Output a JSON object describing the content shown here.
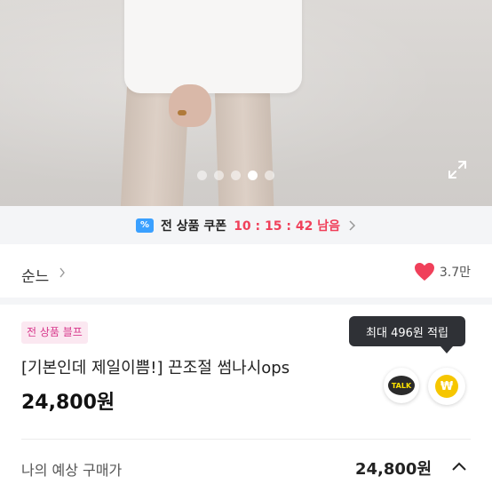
{
  "hero": {
    "slide_count": 5,
    "active_slide": 4
  },
  "coupon": {
    "icon": "coupon-ticket-icon",
    "label": "전 상품 쿠폰",
    "timer": "10 : 15 : 42 남음",
    "accent_color": "#f0405a"
  },
  "shop": {
    "name": "순느",
    "like_count": "3.7만",
    "heart_color": "#f0405a"
  },
  "product": {
    "badge": "전 상품 블프",
    "name": "[기본인데 제일이쁨!] 끈조절 썸나시ops",
    "price": "24,800원",
    "tooltip": "최대 496원 적립",
    "talk_label": "TALK",
    "won_symbol": "₩"
  },
  "expected": {
    "label": "나의 예상 구매가",
    "price": "24,800원"
  }
}
